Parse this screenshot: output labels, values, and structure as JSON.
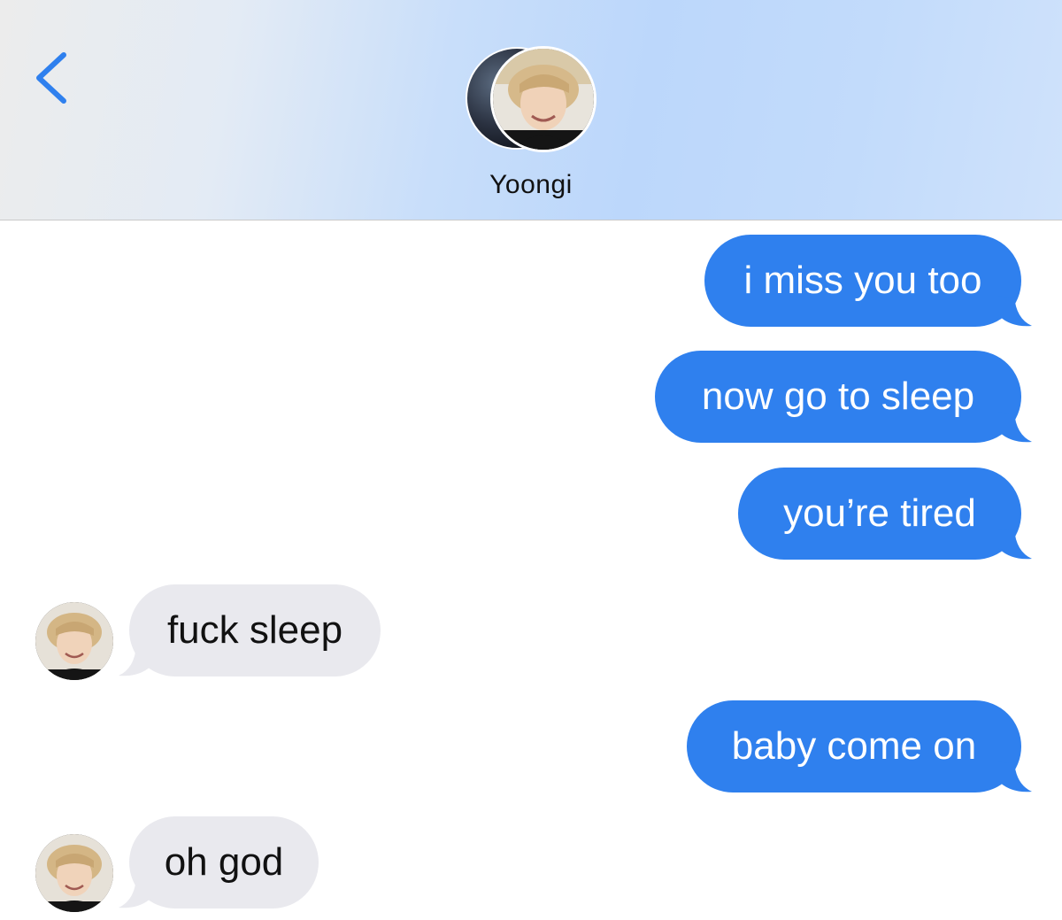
{
  "header": {
    "contact_name": "Yoongi",
    "back_icon": "chevron-left-icon",
    "accent_color": "#2f80ee"
  },
  "messages": [
    {
      "direction": "outgoing",
      "text": "i miss you too"
    },
    {
      "direction": "outgoing",
      "text": "now go to sleep"
    },
    {
      "direction": "outgoing",
      "text": "you’re tired"
    },
    {
      "direction": "incoming",
      "text": "fuck sleep"
    },
    {
      "direction": "outgoing",
      "text": "baby come on"
    },
    {
      "direction": "incoming",
      "text": "oh god"
    }
  ],
  "colors": {
    "outgoing_bubble": "#2f80ee",
    "incoming_bubble": "#e9e9ee"
  }
}
